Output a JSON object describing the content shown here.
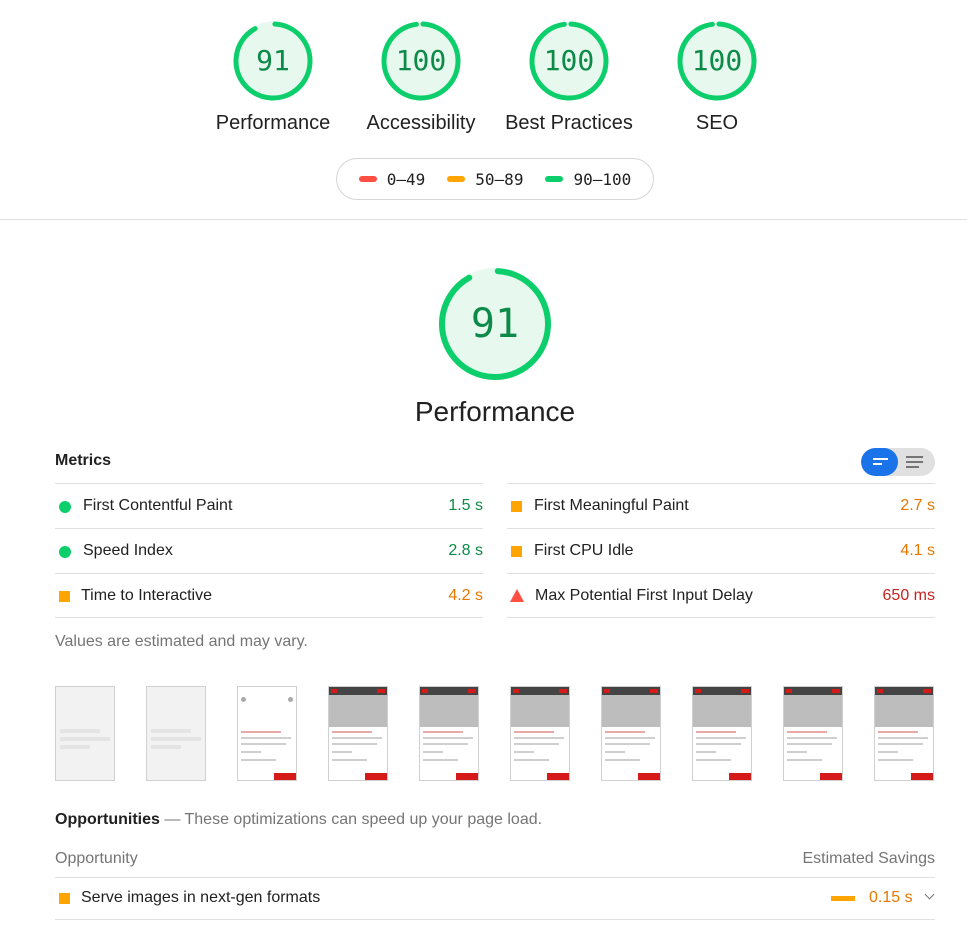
{
  "summary": {
    "gauges": [
      {
        "score": "91",
        "label": "Performance",
        "fraction": 0.91
      },
      {
        "score": "100",
        "label": "Accessibility",
        "fraction": 1.0
      },
      {
        "score": "100",
        "label": "Best Practices",
        "fraction": 1.0
      },
      {
        "score": "100",
        "label": "SEO",
        "fraction": 1.0
      }
    ],
    "legend": [
      {
        "label": "0–49",
        "color": "#ff4e42"
      },
      {
        "label": "50–89",
        "color": "#ffa400"
      },
      {
        "label": "90–100",
        "color": "#0cce6b"
      }
    ]
  },
  "category": {
    "score": "91",
    "fraction": 0.91,
    "title": "Performance"
  },
  "metrics": {
    "heading": "Metrics",
    "left": [
      {
        "name": "First Contentful Paint",
        "value": "1.5 s",
        "rating": "pass"
      },
      {
        "name": "Speed Index",
        "value": "2.8 s",
        "rating": "pass"
      },
      {
        "name": "Time to Interactive",
        "value": "4.2 s",
        "rating": "average"
      }
    ],
    "right": [
      {
        "name": "First Meaningful Paint",
        "value": "2.7 s",
        "rating": "average"
      },
      {
        "name": "First CPU Idle",
        "value": "4.1 s",
        "rating": "average"
      },
      {
        "name": "Max Potential First Input Delay",
        "value": "650 ms",
        "rating": "fail"
      }
    ],
    "note": "Values are estimated and may vary."
  },
  "opportunities": {
    "title": "Opportunities",
    "description": "— These optimizations can speed up your page load.",
    "col_opportunity": "Opportunity",
    "col_savings": "Estimated Savings",
    "items": [
      {
        "name": "Serve images in next-gen formats",
        "savings": "0.15 s",
        "rating": "average"
      }
    ]
  },
  "colors": {
    "pass": "#0cce6b",
    "average": "#ffa400",
    "fail": "#ff4e42"
  }
}
